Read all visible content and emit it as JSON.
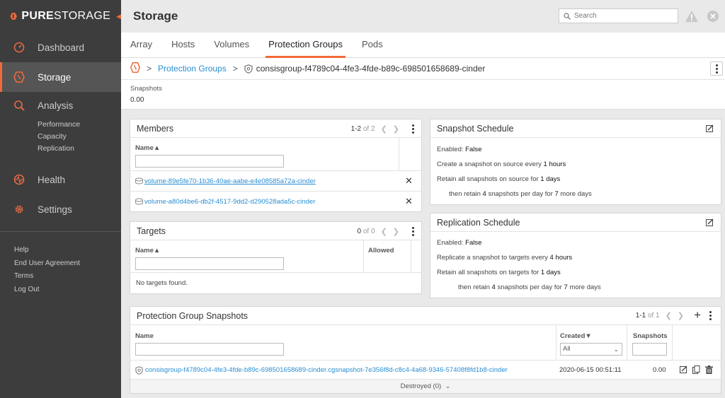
{
  "brand": {
    "name_bold": "PURE",
    "name_rest": "STORAGE"
  },
  "sidebar": {
    "items": [
      {
        "label": "Dashboard",
        "icon": "dashboard-icon"
      },
      {
        "label": "Storage",
        "icon": "storage-icon",
        "active": true
      },
      {
        "label": "Analysis",
        "icon": "analysis-icon"
      },
      {
        "label": "Health",
        "icon": "health-icon"
      },
      {
        "label": "Settings",
        "icon": "settings-icon"
      }
    ],
    "analysis_sub": [
      "Performance",
      "Capacity",
      "Replication"
    ],
    "links": [
      "Help",
      "End User Agreement",
      "Terms",
      "Log Out"
    ]
  },
  "header": {
    "title": "Storage",
    "search_placeholder": "Search"
  },
  "tabs": [
    "Array",
    "Hosts",
    "Volumes",
    "Protection Groups",
    "Pods"
  ],
  "breadcrumb": {
    "link": "Protection Groups",
    "current": "consisgroup-f4789c04-4fe3-4fde-b89c-698501658689-cinder"
  },
  "summary": {
    "label": "Snapshots",
    "value": "0.00"
  },
  "members": {
    "title": "Members",
    "pager_range": "1-2",
    "pager_total": "of 2",
    "col_name": "Name▲",
    "rows": [
      "volume-89e5fe70-1b36-40ae-aabe-e4e08585a72a-cinder",
      "volume-a80d4be6-db2f-4517-9dd2-d290528ada5c-cinder"
    ]
  },
  "targets": {
    "title": "Targets",
    "pager_range": "0",
    "pager_total": "of 0",
    "col_name": "Name▲",
    "col_allowed": "Allowed",
    "empty": "No targets found."
  },
  "snapshot_schedule": {
    "title": "Snapshot Schedule",
    "enabled_label": "Enabled:",
    "enabled": "False",
    "create_prefix": "Create a snapshot on source every",
    "create_value": "1 hours",
    "retain_prefix": "Retain all snapshots on source for",
    "retain_value": "1 days",
    "then_prefix": "then retain",
    "then_count": "4",
    "then_mid": "snapshots per day for",
    "then_days": "7",
    "then_suffix": "more days"
  },
  "replication_schedule": {
    "title": "Replication Schedule",
    "enabled_label": "Enabled:",
    "enabled": "False",
    "create_prefix": "Replicate a snapshot to targets every",
    "create_value": "4 hours",
    "retain_prefix": "Retain all snapshots on targets for",
    "retain_value": "1 days",
    "then_prefix": "then retain",
    "then_count": "4",
    "then_mid": "snapshots per day for",
    "then_days": "7",
    "then_suffix": "more days"
  },
  "pg_snapshots": {
    "title": "Protection Group Snapshots",
    "pager_range": "1-1",
    "pager_total": "of 1",
    "col_name": "Name",
    "col_created": "Created▼",
    "col_snapshots": "Snapshots",
    "created_filter": "All",
    "rows": [
      {
        "name": "consisgroup-f4789c04-4fe3-4fde-b89c-698501658689-cinder.cgsnapshot-7e356f8d-c8c4-4a68-9346-57408f8fd1b8-cinder",
        "created": "2020-06-15 00:51:11",
        "snapshots": "0.00"
      }
    ],
    "destroyed": "Destroyed (0)"
  },
  "colors": {
    "accent": "#f06a3a",
    "link": "#2a8ed3",
    "sidebar": "#3d3d3d"
  }
}
